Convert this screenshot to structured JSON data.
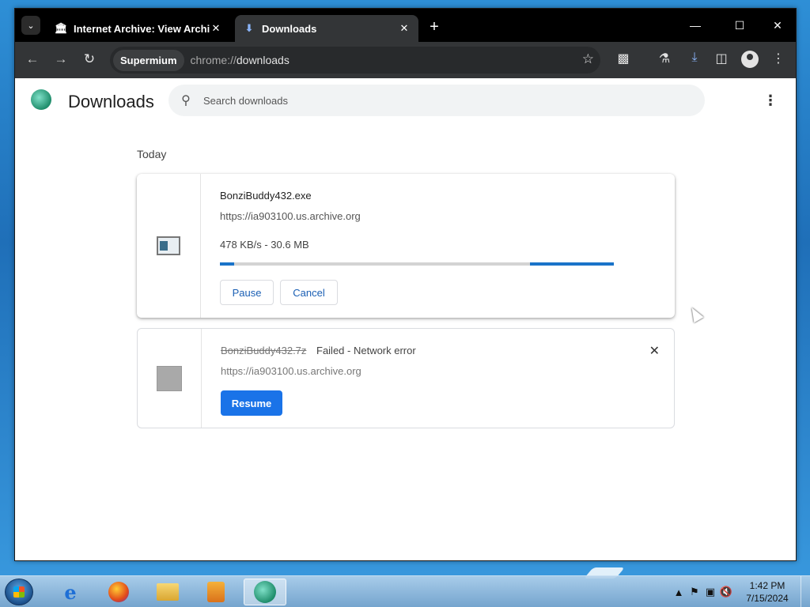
{
  "browser": {
    "tabs": [
      {
        "title": "Internet Archive: View Archive",
        "icon": "archive-building-icon",
        "active": false
      },
      {
        "title": "Downloads",
        "icon": "download-arrow-icon",
        "active": true
      }
    ],
    "omnibox": {
      "chip": "Supermium",
      "url_scheme": "chrome://",
      "url_path": "downloads"
    }
  },
  "downloads_page": {
    "title": "Downloads",
    "search_placeholder": "Search downloads",
    "section_label": "Today",
    "items": [
      {
        "filename": "BonziBuddy432.exe",
        "url": "https://ia903100.us.archive.org",
        "progress_text": "478 KB/s - 30.6 MB",
        "progress_fraction": 0.25,
        "buttons": {
          "pause": "Pause",
          "cancel": "Cancel"
        },
        "icon": "exe-file-icon"
      },
      {
        "filename": "BonziBuddy432.7z",
        "status": "Failed - Network error",
        "url": "https://ia903100.us.archive.org",
        "buttons": {
          "resume": "Resume"
        },
        "icon": "archive-file-icon"
      }
    ]
  },
  "taskbar": {
    "clock_time": "1:42 PM",
    "clock_date": "7/15/2024"
  },
  "colors": {
    "accent": "#1a73e8",
    "progress": "#1a73c9",
    "titlebar": "#000000",
    "toolbar": "#333537"
  }
}
